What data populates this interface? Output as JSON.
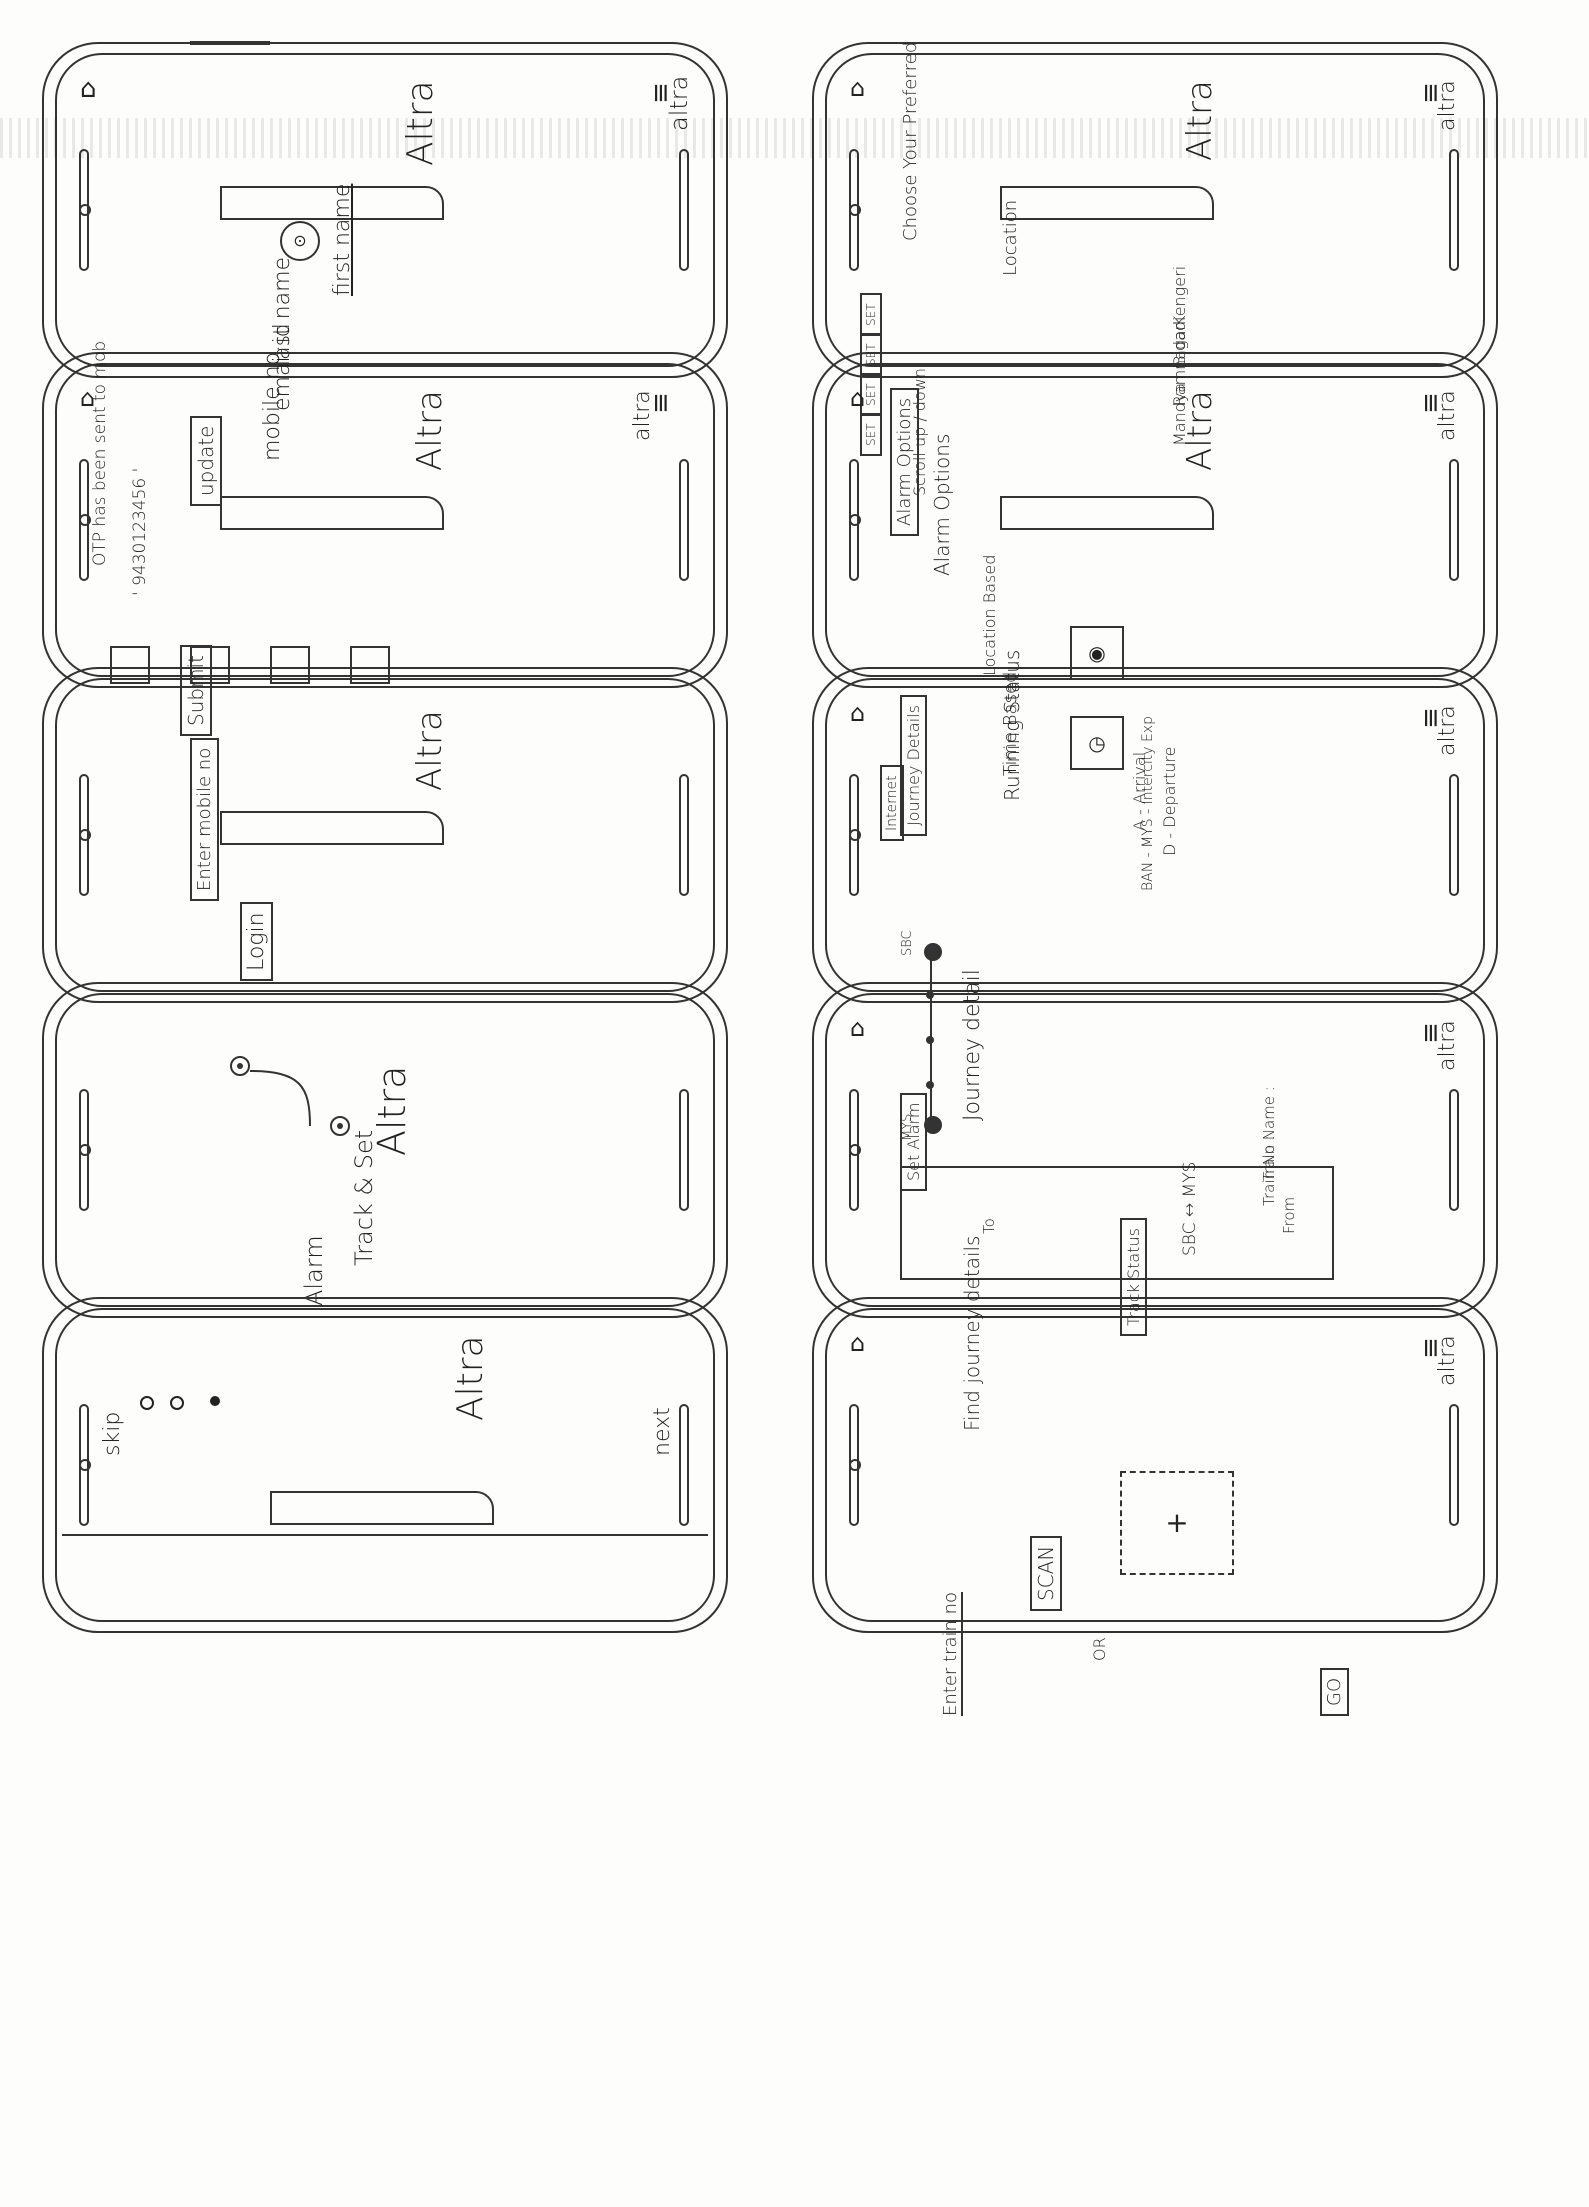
{
  "screens": {
    "splash": {
      "title": "Altra"
    },
    "onboarding": {
      "title": "Altra",
      "caption_1": "Track & Set",
      "caption_2": "Alarm",
      "skip": "skip",
      "next": "next"
    },
    "login": {
      "title": "Altra",
      "input_placeholder": "Enter mobile no",
      "login_button": "Login"
    },
    "otp": {
      "logo": "altra",
      "title": "Altra",
      "message": "OTP has been sent to mob",
      "number": "' 9430123456 '",
      "submit_button": "Submit"
    },
    "profile": {
      "logo": "altra",
      "title": "Altra",
      "first_name": "first name",
      "last_name": "last name",
      "email": "email id",
      "mobile": "mobile no.",
      "update_button": "update"
    },
    "find_journey": {
      "logo": "altra",
      "heading": "Find journey details",
      "scan_button": "SCAN",
      "or": "OR",
      "train_input": "Enter train no",
      "go_button": "GO"
    },
    "journey_detail": {
      "logo": "altra",
      "heading": "Journey detail",
      "train_name": "Train Name :",
      "train_no": "Train No :",
      "from": "From",
      "to": "To",
      "route": "SBC ↔ MYS",
      "track_button": "Track Status"
    },
    "running_status": {
      "logo": "altra",
      "heading": "Running Status",
      "arrival": "A - Arrival",
      "departure": "D - Departure",
      "network": "Internet",
      "train": "BAN - MYS - Intercity Exp",
      "start": "SBC",
      "end": "MYS",
      "alarm_button": "Set Alarm"
    },
    "alarm_options": {
      "logo": "altra",
      "title": "Altra",
      "heading": "Alarm Options",
      "location": "Location Based",
      "time": "Time Based",
      "journey_button": "Journey Details"
    },
    "location": {
      "logo": "altra",
      "title": "Altra",
      "heading_1": "Choose Your Preferred",
      "heading_2": "Location",
      "stations": [
        "Kengeri",
        "Bidadi",
        "Ramnagar",
        "Mandya"
      ],
      "set": "SET",
      "scroll": "Scroll up / down",
      "alarm_button": "Alarm Options"
    }
  }
}
